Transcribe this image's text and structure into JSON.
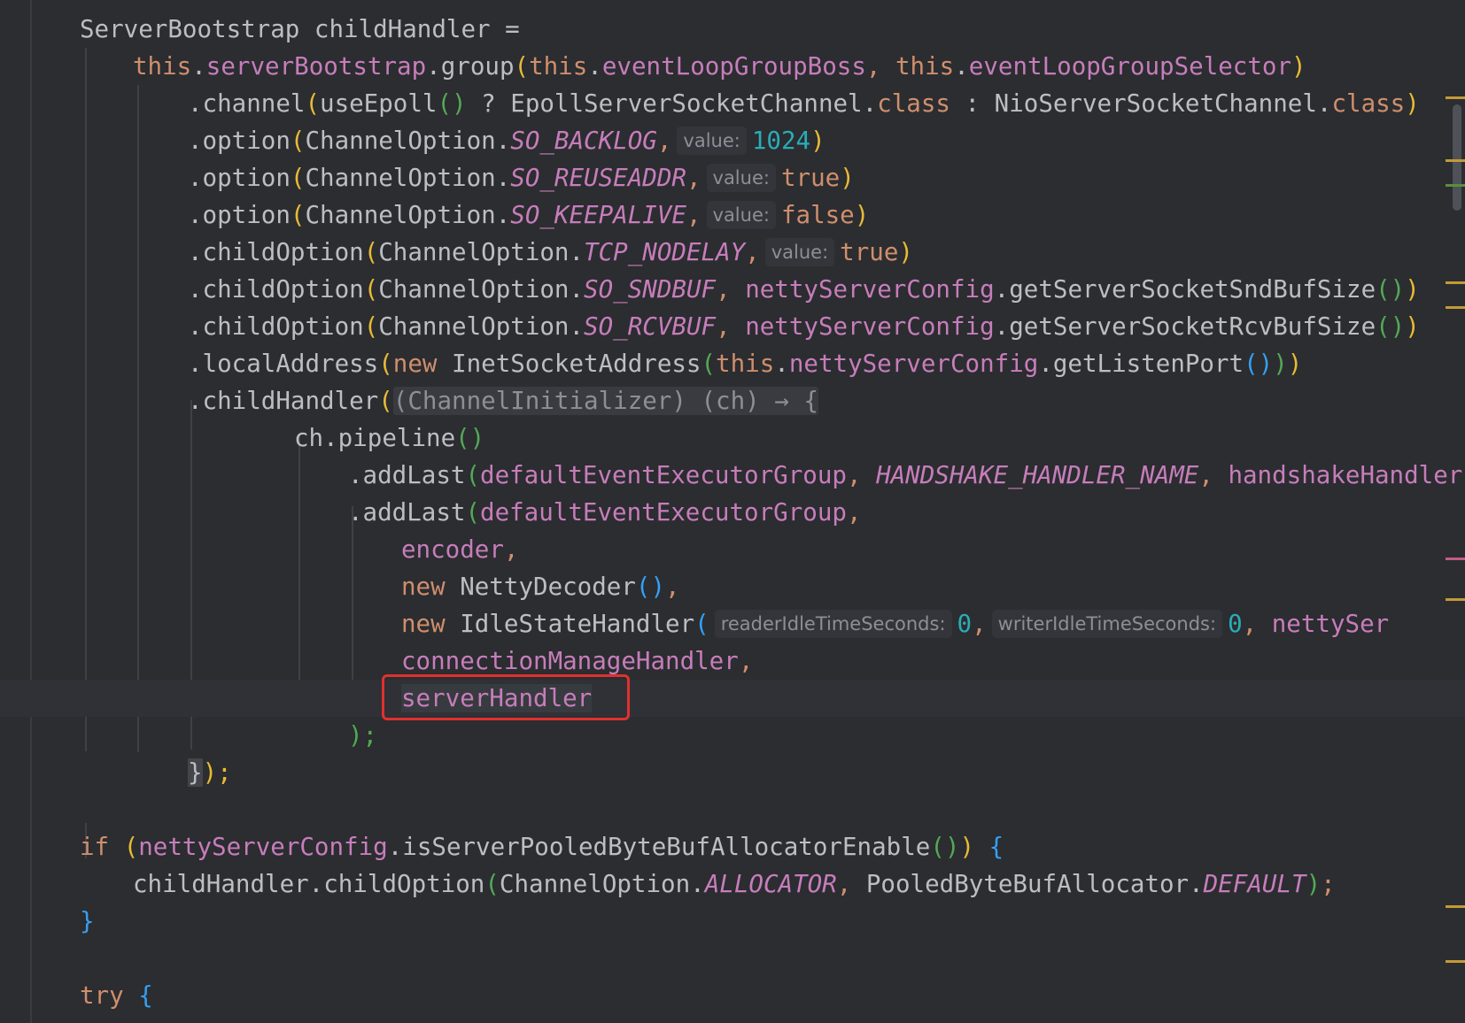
{
  "editor": {
    "highlighted_token": "serverHandler",
    "colors": {
      "background": "#2b2d30",
      "keyword": "#cf8e6d",
      "field": "#c77dbb",
      "number": "#2aacb8",
      "highlight_border": "#e0312e"
    }
  },
  "code": {
    "l1": {
      "a": "ServerBootstrap childHandler ="
    },
    "l2": {
      "kw1": "this",
      "f1": "serverBootstrap",
      "m": ".group",
      "p1": "(",
      "kw2": "this",
      "f2": "eventLoopGroupBoss",
      "c": ", ",
      "kw3": "this",
      "f3": "eventLoopGroupSelector",
      "p2": ")"
    },
    "l3": {
      "m": ".channel",
      "p1": "(",
      "fn": "useEpoll",
      "p2": "()",
      "t": " ? EpollServerSocketChannel.",
      "kw1": "class",
      "t2": " : NioServerSocketChannel.",
      "kw2": "class",
      "p3": ")"
    },
    "l4": {
      "m": ".option",
      "p1": "(",
      "cls": "ChannelOption.",
      "st": "SO_BACKLOG",
      "c": ",",
      "hint": "value:",
      "val": "1024",
      "p2": ")"
    },
    "l5": {
      "m": ".option",
      "p1": "(",
      "cls": "ChannelOption.",
      "st": "SO_REUSEADDR",
      "c": ",",
      "hint": "value:",
      "val": "true",
      "p2": ")"
    },
    "l6": {
      "m": ".option",
      "p1": "(",
      "cls": "ChannelOption.",
      "st": "SO_KEEPALIVE",
      "c": ",",
      "hint": "value:",
      "val": "false",
      "p2": ")"
    },
    "l7": {
      "m": ".childOption",
      "p1": "(",
      "cls": "ChannelOption.",
      "st": "TCP_NODELAY",
      "c": ",",
      "hint": "value:",
      "val": "true",
      "p2": ")"
    },
    "l8": {
      "m": ".childOption",
      "p1": "(",
      "cls": "ChannelOption.",
      "st": "SO_SNDBUF",
      "c": ", ",
      "f": "nettyServerConfig",
      "call": ".getServerSocketSndBufSize",
      "p2": "()",
      "p3": ")"
    },
    "l9": {
      "m": ".childOption",
      "p1": "(",
      "cls": "ChannelOption.",
      "st": "SO_RCVBUF",
      "c": ", ",
      "f": "nettyServerConfig",
      "call": ".getServerSocketRcvBufSize",
      "p2": "()",
      "p3": ")"
    },
    "l10": {
      "m": ".localAddress",
      "p1": "(",
      "kw1": "new",
      "t": " InetSocketAddress",
      "p2": "(",
      "kw2": "this",
      "dot": ".",
      "f": "nettyServerConfig",
      "call": ".getListenPort",
      "p3": "()",
      "p4": ")",
      "p5": ")"
    },
    "l11": {
      "m": ".childHandler",
      "p1": "(",
      "lam": "(ChannelInitializer) (ch) → {"
    },
    "l12": {
      "t": "ch.pipeline",
      "p": "()"
    },
    "l13": {
      "m": ".addLast",
      "p1": "(",
      "f1": "defaultEventExecutorGroup",
      "c1": ", ",
      "st": "HANDSHAKE_HANDLER_NAME",
      "c2": ", ",
      "f2": "handshakeHandler",
      "p2": ")"
    },
    "l14": {
      "m": ".addLast",
      "p1": "(",
      "f1": "defaultEventExecutorGroup",
      "c1": ","
    },
    "l15": {
      "f": "encoder",
      "c": ","
    },
    "l16": {
      "kw": "new",
      "t": " NettyDecoder",
      "p": "()",
      "c": ","
    },
    "l17": {
      "kw": "new",
      "t": " IdleStateHandler",
      "p": "(",
      "h1": "readerIdleTimeSeconds:",
      "v1": "0",
      "c1": ",",
      "h2": "writerIdleTimeSeconds:",
      "v2": "0",
      "c2": ", ",
      "f": "nettySer"
    },
    "l18": {
      "f": "connectionManageHandler",
      "c": ","
    },
    "l19": {
      "f": "serverHandler"
    },
    "l20": {
      "p": ");"
    },
    "l21": {
      "b": "}",
      "p": ");"
    },
    "l22": {
      "t": ""
    },
    "l23": {
      "kw": "if",
      "sp": " ",
      "p1": "(",
      "f": "nettyServerConfig",
      "call": ".isServerPooledByteBufAllocatorEnable",
      "p2": "()",
      "p3": ")",
      "sp2": " ",
      "b": "{"
    },
    "l24": {
      "t": "childHandler.childOption",
      "p1": "(",
      "cls": "ChannelOption.",
      "st1": "ALLOCATOR",
      "c": ", ",
      "cls2": "PooledByteBufAllocator.",
      "st2": "DEFAULT",
      "p2": ")",
      "semi": ";"
    },
    "l25": {
      "b": "}"
    },
    "l26": {
      "t": ""
    },
    "l27": {
      "kw": "try",
      "sp": " ",
      "b": "{"
    }
  }
}
